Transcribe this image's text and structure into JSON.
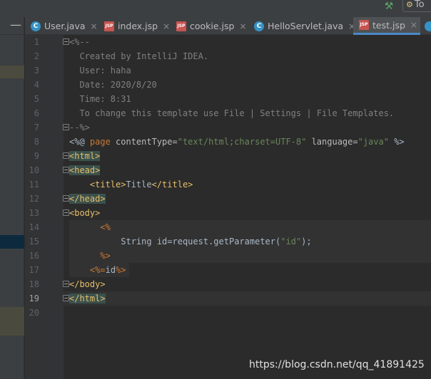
{
  "toolbar": {
    "hammer_icon": "hammer-icon",
    "run_button_label": "To"
  },
  "left_panel": {
    "collapse_label": "—"
  },
  "tabs": [
    {
      "label": "User.java",
      "icon": "java-class-icon"
    },
    {
      "label": "index.jsp",
      "icon": "jsp-file-icon"
    },
    {
      "label": "cookie.jsp",
      "icon": "jsp-file-icon"
    },
    {
      "label": "HelloServlet.java",
      "icon": "java-class-icon"
    },
    {
      "label": "test.jsp",
      "icon": "jsp-file-icon",
      "active": true
    }
  ],
  "editor": {
    "line_numbers": [
      "1",
      "2",
      "3",
      "4",
      "5",
      "6",
      "7",
      "8",
      "9",
      "10",
      "11",
      "12",
      "13",
      "14",
      "15",
      "16",
      "17",
      "18",
      "19",
      "20"
    ],
    "current_line": 19,
    "code": {
      "l1": "<%--",
      "l2": "  Created by IntelliJ IDEA.",
      "l3": "  User: haha",
      "l4": "  Date: 2020/8/20",
      "l5": "  Time: 8:31",
      "l6": "  To change this template use File | Settings | File Templates.",
      "l7": "--%>",
      "l8": {
        "open": "<%@ ",
        "kw": "page",
        "attr1": " contentType=",
        "val1": "\"text/html;charset=UTF-8\"",
        "attr2": " language=",
        "val2": "\"java\"",
        "close": " %>"
      },
      "l9": "<html>",
      "l10": "<head>",
      "l11": {
        "indent": "    ",
        "open": "<title>",
        "text": "Title",
        "close": "</title>"
      },
      "l12": "</head>",
      "l13": "<body>",
      "l14": {
        "indent": "      ",
        "text": "<%"
      },
      "l15": {
        "indent": "          ",
        "text": "String id=request.getParameter(",
        "str": "\"id\"",
        "end": ");"
      },
      "l16": {
        "indent": "      ",
        "text": "%>"
      },
      "l17": {
        "indent": "    ",
        "open": "<%=",
        "text": "id",
        "close": "%>"
      },
      "l18": "</body>",
      "l19": "</html>",
      "l20": ""
    }
  },
  "watermark": "https://blog.csdn.net/qq_41891425"
}
